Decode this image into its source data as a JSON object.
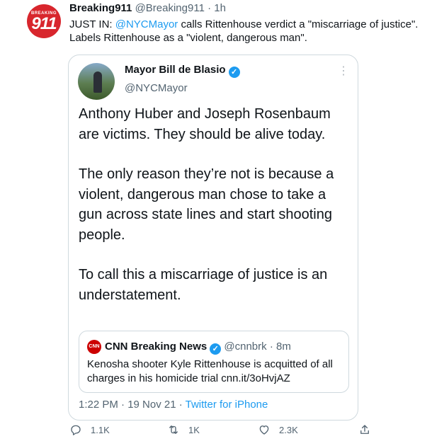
{
  "tweet": {
    "avatar_text_top": "BREAKING",
    "avatar_text_num": "911",
    "author_name": "Breaking911",
    "author_handle": "@Breaking911",
    "separator": "·",
    "time": "1h",
    "text_prefix": "JUST IN: ",
    "mention": "@NYCMayor",
    "text_suffix": " calls Rittenhouse verdict a \"miscarriage of justice\". Labels Rittenhouse as a \"violent, dangerous man\".",
    "actions": {
      "reply_count": "1.1K",
      "retweet_count": "1K",
      "like_count": "2.3K"
    }
  },
  "quoted": {
    "author_name": "Mayor Bill de Blasio",
    "verified_glyph": "✓",
    "author_handle": "@NYCMayor",
    "more_glyph": "⋮",
    "paragraphs": [
      "Anthony Huber and Joseph Rosenbaum are victims. They should be alive today.",
      "The only reason they’re not is because a violent, dangerous man chose to take a gun across state lines and start shooting people.",
      "To call this a miscarriage of justice is an understatement."
    ],
    "nested": {
      "logo_text": "CNN",
      "author_name": "CNN Breaking News",
      "verified_glyph": "✓",
      "author_handle": "@cnnbrk",
      "separator": "·",
      "time": "8m",
      "text": "Kenosha shooter Kyle Rittenhouse is acquitted of all charges in his homicide trial cnn.it/3oHvjAZ"
    },
    "timestamp": "1:22 PM · 19 Nov 21 · ",
    "source": "Twitter for iPhone"
  },
  "colors": {
    "accent": "#1d9bf0",
    "muted": "#536471",
    "border": "#cfd9de",
    "brand_red": "#d8262d"
  },
  "icons": [
    "reply-icon",
    "retweet-icon",
    "like-icon",
    "share-icon",
    "verified-icon",
    "more-icon"
  ]
}
